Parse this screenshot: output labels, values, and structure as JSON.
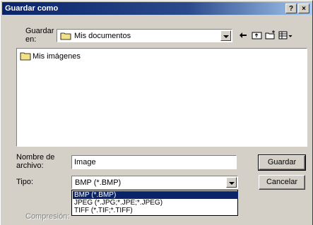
{
  "window": {
    "title": "Guardar como",
    "help_label": "?",
    "close_label": "×"
  },
  "location": {
    "label_line1": "Guardar",
    "label_line2": "en:",
    "value": "Mis documentos"
  },
  "files": [
    {
      "name": "Mis imágenes"
    }
  ],
  "filename": {
    "label_line1": "Nombre de",
    "label_line2": "archivo:",
    "value": "Image"
  },
  "filetype": {
    "label": "Tipo:",
    "value": "BMP (*.BMP)",
    "options": [
      "BMP (*.BMP)",
      "JPEG (*.JPG;*.JPE;*.JPEG)",
      "TIFF (*.TIF;*.TIFF)"
    ]
  },
  "compression": {
    "label": "Compresión:"
  },
  "buttons": {
    "save": "Guardar",
    "cancel": "Cancelar"
  }
}
